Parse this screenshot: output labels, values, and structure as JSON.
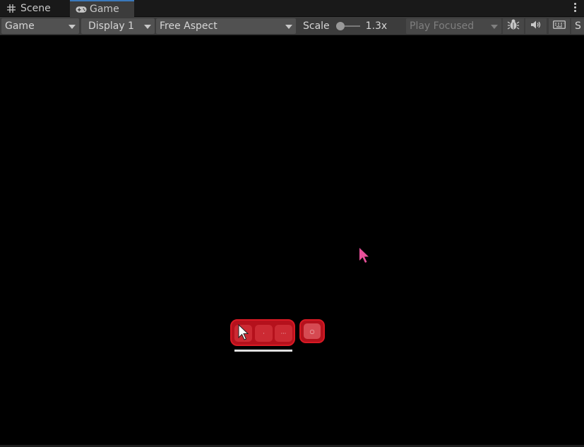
{
  "tabs": [
    {
      "label": "Scene",
      "icon": "grid-icon",
      "active": false
    },
    {
      "label": "Game",
      "icon": "gamepad-icon",
      "active": true
    }
  ],
  "toolbar": {
    "view_select": "Game",
    "display_select": "Display 1",
    "aspect_select": "Free Aspect",
    "scale_label": "Scale",
    "scale_value": "1.3x",
    "scale_fraction": 0.0,
    "play_mode_select": "Play Focused",
    "stats_label": "S"
  },
  "game_view": {
    "hud_slots": [
      {
        "icon": "cursor-arrow-icon"
      },
      {
        "glyph": "·"
      },
      {
        "glyph": "···"
      }
    ],
    "hud_single_slot": {
      "glyph": "○"
    }
  },
  "colors": {
    "tab_active_accent": "#3a79bb",
    "hud_red": "#b5111c",
    "cursor_pink": "#e8509a"
  }
}
